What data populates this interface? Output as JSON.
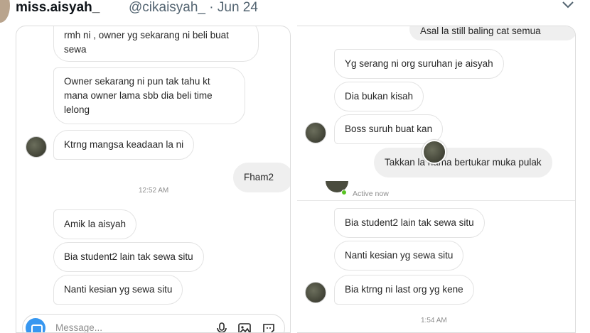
{
  "tweet": {
    "display_name": "miss.aisyah_",
    "handle_date": "@cikaisyah_ · Jun 24"
  },
  "left_chat": {
    "messages": [
      {
        "text": "rmh ni , owner yg sekarang ni beli buat sewa"
      },
      {
        "text": "Owner sekarang ni pun tak tahu kt mana owner lama sbb dia beli time lelong"
      },
      {
        "text": "Ktrng mangsa keadaan la ni"
      },
      {
        "text": "Fham2"
      },
      {
        "text": "Amik la aisyah"
      },
      {
        "text": "Bia student2 lain tak sewa situ"
      },
      {
        "text": "Nanti kesian yg sewa situ"
      }
    ],
    "timestamp": "12:52 AM",
    "composer_placeholder": "Message..."
  },
  "right_chat": {
    "messages": [
      {
        "text": "Asal la still baling cat semua"
      },
      {
        "text": "Yg serang ni org suruhan je aisyah"
      },
      {
        "text": "Dia bukan kisah"
      },
      {
        "text": "Boss suruh buat kan"
      },
      {
        "text": "Takkan la nama bertukar muka pulak"
      },
      {
        "text": "Bia student2 lain tak sewa situ"
      },
      {
        "text": "Nanti kesian yg sewa situ"
      },
      {
        "text": "Bia ktrng ni last org yg kene"
      }
    ],
    "status": "Active now",
    "timestamp": "1:54 AM"
  }
}
